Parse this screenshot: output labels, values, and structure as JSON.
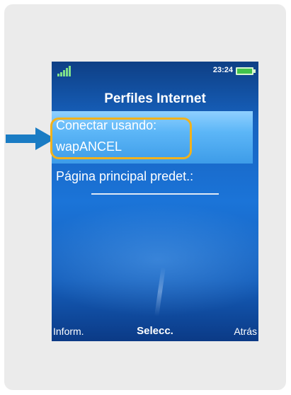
{
  "status": {
    "time": "23:24"
  },
  "screen": {
    "title": "Perfiles Internet",
    "items": [
      {
        "label": "Conectar usando:",
        "value": "wapANCEL"
      },
      {
        "label": "Página principal predet.:"
      }
    ]
  },
  "softkeys": {
    "left": "Inform.",
    "center": "Selecc.",
    "right": "Atrás"
  },
  "colors": {
    "arrow": "#1a7cc4",
    "highlight_ring": "#f2b21b",
    "selection": "#5cb6f7"
  },
  "icons": {
    "pointer": "arrow-right-icon",
    "signal": "signal-strength-icon",
    "battery": "battery-icon"
  }
}
